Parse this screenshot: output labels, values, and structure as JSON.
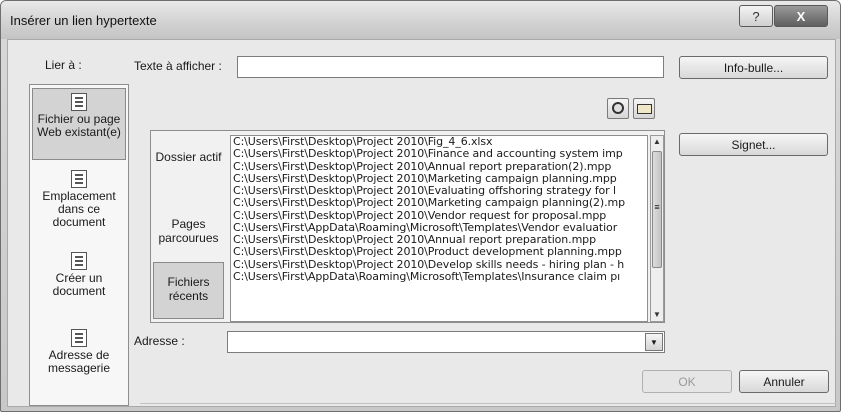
{
  "window": {
    "title": "Insérer un lien hypertexte",
    "help_glyph": "?",
    "close_glyph": "X"
  },
  "link_to": {
    "label": "Lier à :",
    "items": [
      {
        "icon": "web-page-icon",
        "label": "Fichier ou page Web existant(e)",
        "selected": true
      },
      {
        "icon": "document-place-icon",
        "label": "Emplacement dans ce document",
        "selected": false
      },
      {
        "icon": "new-document-icon",
        "label": "Créer un document",
        "selected": false
      },
      {
        "icon": "email-address-icon",
        "label": "Adresse de messagerie",
        "selected": false
      }
    ]
  },
  "text_to_display": {
    "label": "Texte à afficher :",
    "value": ""
  },
  "buttons": {
    "screentip": "Info-bulle...",
    "bookmark": "Signet...",
    "ok": "OK",
    "cancel": "Annuler"
  },
  "look_in_icons": [
    "browse-web-icon",
    "browse-file-icon"
  ],
  "browse_tabs": [
    {
      "label": "Dossier actif",
      "selected": false
    },
    {
      "label": "Pages parcourues",
      "selected": false
    },
    {
      "label": "Fichiers récents",
      "selected": true
    }
  ],
  "recent_files": [
    "C:\\Users\\First\\Desktop\\Project 2010\\Fig_4_6.xlsx",
    "C:\\Users\\First\\Desktop\\Project 2010\\Finance and accounting system imp",
    "C:\\Users\\First\\Desktop\\Project 2010\\Annual report preparation(2).mpp",
    "C:\\Users\\First\\Desktop\\Project 2010\\Marketing campaign planning.mpp",
    "C:\\Users\\First\\Desktop\\Project 2010\\Evaluating offshoring strategy for l",
    "C:\\Users\\First\\Desktop\\Project 2010\\Marketing campaign planning(2).mp",
    "C:\\Users\\First\\Desktop\\Project 2010\\Vendor request for proposal.mpp",
    "C:\\Users\\First\\AppData\\Roaming\\Microsoft\\Templates\\Vendor evaluatior",
    "C:\\Users\\First\\Desktop\\Project 2010\\Annual report preparation.mpp",
    "C:\\Users\\First\\Desktop\\Project 2010\\Product development planning.mpp",
    "C:\\Users\\First\\Desktop\\Project 2010\\Develop skills needs - hiring plan - h",
    "C:\\Users\\First\\AppData\\Roaming\\Microsoft\\Templates\\Insurance claim pı"
  ],
  "scrollbar_marker": "≡",
  "address": {
    "label": "Adresse :",
    "value": ""
  }
}
